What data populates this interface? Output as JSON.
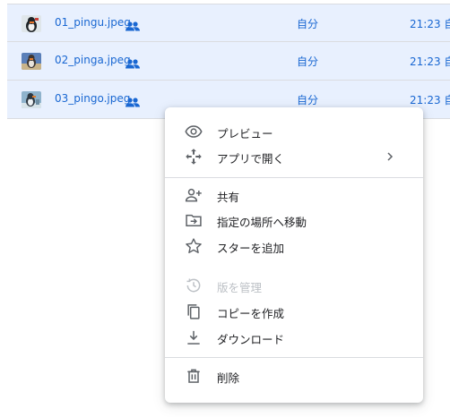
{
  "files": [
    {
      "name": "01_pingu.jpeg",
      "owner": "自分",
      "modified": "21:23 自"
    },
    {
      "name": "02_pinga.jpeg",
      "owner": "自分",
      "modified": "21:23 自"
    },
    {
      "name": "03_pingo.jpeg",
      "owner": "自分",
      "modified": "21:23 自"
    }
  ],
  "context_menu": {
    "preview": "プレビュー",
    "open_with": "アプリで開く",
    "share": "共有",
    "move_to": "指定の場所へ移動",
    "add_star": "スターを追加",
    "manage_versions": "版を管理",
    "make_copy": "コピーを作成",
    "download": "ダウンロード",
    "delete": "削除"
  },
  "icons": {
    "preview": "eye-icon",
    "open_with": "move-arrows-icon",
    "share": "person-add-icon",
    "move_to": "folder-move-icon",
    "add_star": "star-outline-icon",
    "manage_versions": "history-icon",
    "make_copy": "copy-icon",
    "download": "download-icon",
    "delete": "trash-icon"
  },
  "colors": {
    "selected_row": "#e8f0fe",
    "accent_text": "#1967d2",
    "menu_text": "#202124",
    "disabled_text": "#bdc1c6"
  }
}
